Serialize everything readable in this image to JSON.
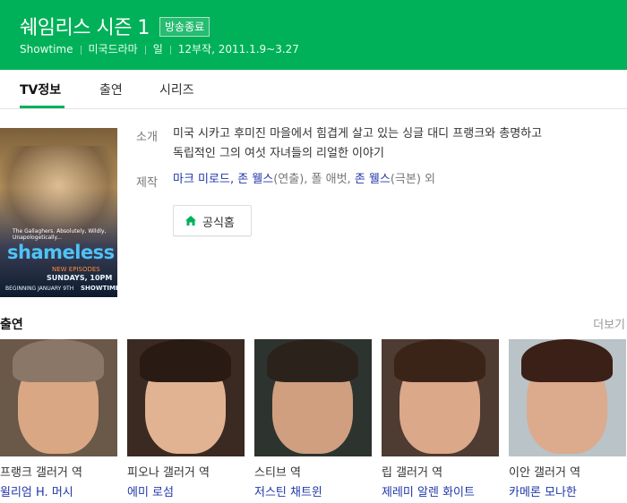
{
  "header": {
    "title": "쉐임리스 시즌 1",
    "badge": "방송종료",
    "meta": [
      "Showtime",
      "미국드라마",
      "일",
      "12부작, 2011.1.9~3.27"
    ]
  },
  "tabs": [
    "TV정보",
    "출연",
    "시리즈"
  ],
  "poster": {
    "logo_text": "shameless",
    "tagline": "The Gallaghers. Absolutely, Wildly, Unapologetically...",
    "new_episodes": "NEW EPISODES",
    "time": "SUNDAYS, 10PM",
    "begin": "BEGINNING JANUARY 9TH",
    "network": "SHOWTIME"
  },
  "info": {
    "synopsis_label": "소개",
    "synopsis_line1": "미국 시카고 후미진 마을에서 힘겹게 살고 있는 싱글 대디 프랭크와 총명하고",
    "synopsis_line2": "독립적인 그의 여섯 자녀들의 리얼한 이야기",
    "production_label": "제작",
    "production": {
      "p1": "마크 미로드",
      "p2": ", ",
      "p3": "존 웰스",
      "p4": "(연출), 폴 애벗, ",
      "p5": "존 웰스",
      "p6": "(극본) 외"
    },
    "home_button": "공식홈"
  },
  "cast_section": {
    "title": "출연",
    "more": "더보기"
  },
  "cast": [
    {
      "role": "프랭크 갤러거 역",
      "actor": "윌리엄 H. 머시"
    },
    {
      "role": "피오나 갤러거 역",
      "actor": "에미 로섬"
    },
    {
      "role": "스티브 역",
      "actor": "저스틴 채트윈"
    },
    {
      "role": "립 갤러거 역",
      "actor": "제레미 알렌 화이트"
    },
    {
      "role": "이안 갤러거 역",
      "actor": "카메론 모나한"
    }
  ],
  "colors": {
    "brand_green": "#00b159",
    "link_blue": "#2137a8"
  },
  "icons": [
    "house-icon"
  ]
}
